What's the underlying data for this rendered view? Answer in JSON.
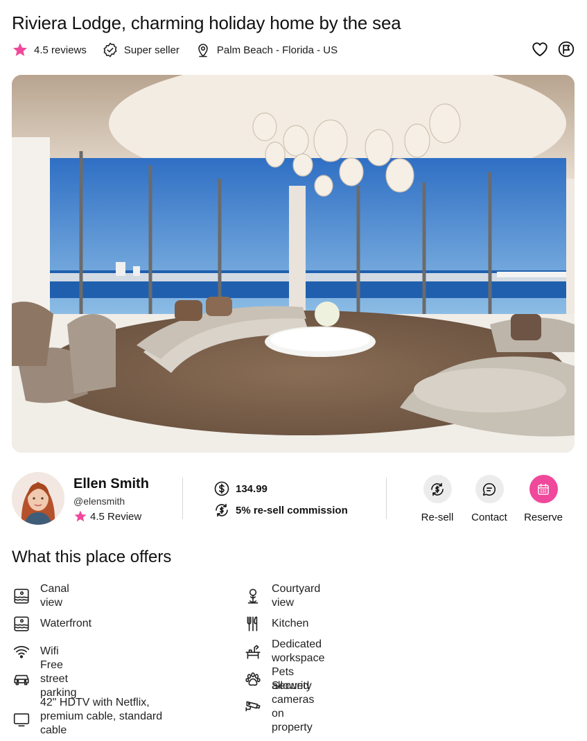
{
  "listing": {
    "title": "Riviera Lodge, charming holiday home by the sea",
    "rating_text": "4.5 reviews",
    "seller_badge": "Super seller",
    "location": "Palm Beach - Florida - US",
    "accent_color": "#f0489a"
  },
  "top_actions": {
    "favorite_icon": "heart-icon",
    "share_icon": "flag-icon"
  },
  "host": {
    "name": "Ellen Smith",
    "handle": "@elensmith",
    "rating": "4.5 Review",
    "price": "134.99",
    "commission": "5% re-sell commission"
  },
  "buttons": {
    "resell": "Re-sell",
    "contact": "Contact",
    "reserve": "Reserve"
  },
  "offers": {
    "title": "What this place offers",
    "left": [
      {
        "label": "Canal view",
        "icon": "canal-view-icon"
      },
      {
        "label": "Waterfront",
        "icon": "waterfront-icon"
      },
      {
        "label": "Wifi",
        "icon": "wifi-icon"
      },
      {
        "label": "Free street parking",
        "icon": "car-icon"
      },
      {
        "label": "42\" HDTV with Netflix, premium cable, standard cable",
        "icon": "tv-icon"
      }
    ],
    "right": [
      {
        "label": "Courtyard view",
        "icon": "courtyard-icon"
      },
      {
        "label": "Kitchen",
        "icon": "kitchen-icon"
      },
      {
        "label": "Dedicated workspace",
        "icon": "workspace-icon"
      },
      {
        "label": "Pets allowed",
        "icon": "paw-icon"
      },
      {
        "label": "Security cameras on property",
        "icon": "camera-icon"
      }
    ]
  }
}
